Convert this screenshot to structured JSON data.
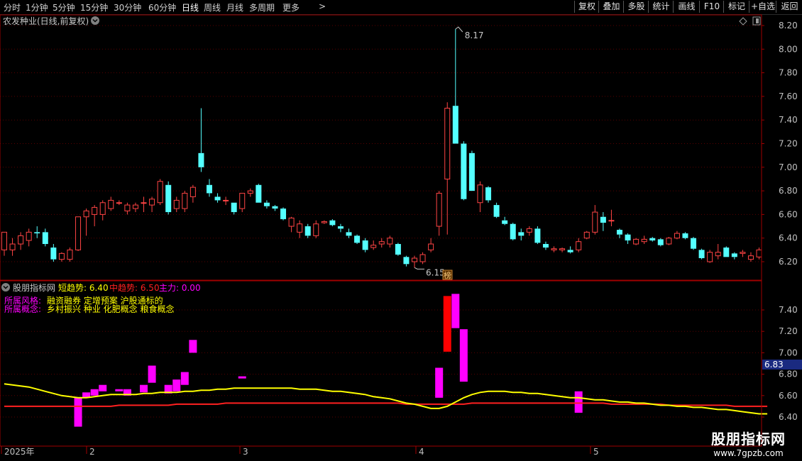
{
  "toolbar": {
    "periods": [
      "分时",
      "1分钟",
      "5分钟",
      "15分钟",
      "30分钟",
      "60分钟",
      "日线",
      "周线",
      "月线",
      "多周期",
      "更多"
    ],
    "active": "日线",
    "more_arrow": ">",
    "right_buttons": [
      "复权",
      "叠加",
      "多股",
      "统计",
      "画线",
      "F10",
      "标记",
      "+自选",
      "返回"
    ]
  },
  "main_panel": {
    "title": "农发种业(日线,前复权)",
    "dropdown_icon": "chevron-down-circle-icon",
    "high_label": "8.17",
    "low_label": "6.15",
    "badge": "榜"
  },
  "sub_panel": {
    "indicator_name": "股朋指标网",
    "legend": [
      {
        "label": "短趋势: 6.40",
        "color": "#ffff00"
      },
      {
        "label": "中趋势: 6.50",
        "color": "#ff2020"
      },
      {
        "label": "主力: 0.00",
        "color": "#ff00ff"
      }
    ],
    "style_label": "所属风格:",
    "style_value": "融资融券 定增预案 沪股通标的",
    "concept_label": "所属概念:",
    "concept_value": "乡村振兴 种业 化肥概念 粮食概念",
    "current_price_tag": "6.83"
  },
  "time_axis": [
    "2025年",
    "2",
    "3",
    "4",
    "5"
  ],
  "watermark": {
    "title": "股朋指标网",
    "url": "www.7gpzb.com"
  },
  "colors": {
    "up": "#ff4444",
    "down": "#54ffff",
    "short_trend": "#ffff00",
    "mid_trend": "#ff2020",
    "main_force": "#ff00ff",
    "grid": "#5a0000",
    "axis": "#a00000"
  },
  "chart_data": [
    {
      "type": "candlestick",
      "title": "农发种业(日线,前复权)",
      "ylim": [
        6.1,
        8.3
      ],
      "yticks": [
        6.2,
        6.4,
        6.6,
        6.8,
        7.0,
        7.2,
        7.4,
        7.6,
        7.8,
        8.0,
        8.2
      ],
      "ohlc": [
        [
          6.3,
          6.45,
          6.25,
          6.45
        ],
        [
          6.3,
          6.4,
          6.25,
          6.35
        ],
        [
          6.35,
          6.45,
          6.3,
          6.42
        ],
        [
          6.38,
          6.48,
          6.33,
          6.45
        ],
        [
          6.45,
          6.5,
          6.4,
          6.44
        ],
        [
          6.45,
          6.48,
          6.33,
          6.35
        ],
        [
          6.32,
          6.35,
          6.2,
          6.22
        ],
        [
          6.22,
          6.28,
          6.2,
          6.27
        ],
        [
          6.22,
          6.32,
          6.2,
          6.3
        ],
        [
          6.3,
          6.58,
          6.29,
          6.58
        ],
        [
          6.58,
          6.65,
          6.42,
          6.63
        ],
        [
          6.6,
          6.68,
          6.5,
          6.66
        ],
        [
          6.6,
          6.72,
          6.55,
          6.7
        ],
        [
          6.65,
          6.75,
          6.63,
          6.72
        ],
        [
          6.7,
          6.72,
          6.68,
          6.7
        ],
        [
          6.63,
          6.7,
          6.6,
          6.68
        ],
        [
          6.65,
          6.7,
          6.62,
          6.68
        ],
        [
          6.7,
          6.75,
          6.62,
          6.7
        ],
        [
          6.68,
          6.75,
          6.62,
          6.73
        ],
        [
          6.7,
          6.9,
          6.68,
          6.88
        ],
        [
          6.85,
          6.88,
          6.6,
          6.62
        ],
        [
          6.65,
          6.75,
          6.62,
          6.72
        ],
        [
          6.65,
          6.8,
          6.62,
          6.78
        ],
        [
          6.75,
          6.85,
          6.7,
          6.83
        ],
        [
          7.12,
          7.5,
          6.96,
          7.0
        ],
        [
          6.85,
          6.9,
          6.75,
          6.78
        ],
        [
          6.75,
          6.78,
          6.7,
          6.72
        ],
        [
          6.72,
          6.75,
          6.68,
          6.72
        ],
        [
          6.7,
          6.7,
          6.6,
          6.62
        ],
        [
          6.65,
          6.78,
          6.62,
          6.78
        ],
        [
          6.78,
          6.82,
          6.75,
          6.8
        ],
        [
          6.85,
          6.86,
          6.7,
          6.7
        ],
        [
          6.7,
          6.72,
          6.65,
          6.67
        ],
        [
          6.67,
          6.68,
          6.63,
          6.65
        ],
        [
          6.65,
          6.66,
          6.55,
          6.56
        ],
        [
          6.5,
          6.58,
          6.45,
          6.57
        ],
        [
          6.45,
          6.55,
          6.4,
          6.52
        ],
        [
          6.5,
          6.52,
          6.4,
          6.42
        ],
        [
          6.42,
          6.55,
          6.4,
          6.52
        ],
        [
          6.53,
          6.55,
          6.52,
          6.54
        ],
        [
          6.55,
          6.56,
          6.5,
          6.51
        ],
        [
          6.5,
          6.52,
          6.45,
          6.48
        ],
        [
          6.45,
          6.48,
          6.4,
          6.42
        ],
        [
          6.42,
          6.43,
          6.35,
          6.36
        ],
        [
          6.38,
          6.4,
          6.28,
          6.3
        ],
        [
          6.32,
          6.38,
          6.3,
          6.34
        ],
        [
          6.35,
          6.4,
          6.32,
          6.37
        ],
        [
          6.35,
          6.42,
          6.32,
          6.4
        ],
        [
          6.35,
          6.36,
          6.25,
          6.26
        ],
        [
          6.24,
          6.25,
          6.16,
          6.18
        ],
        [
          6.2,
          6.25,
          6.15,
          6.23
        ],
        [
          6.2,
          6.28,
          6.18,
          6.26
        ],
        [
          6.3,
          6.4,
          6.28,
          6.35
        ],
        [
          6.5,
          6.8,
          6.42,
          6.78
        ],
        [
          6.9,
          7.55,
          6.43,
          7.5
        ],
        [
          7.52,
          8.17,
          7.2,
          7.2
        ],
        [
          7.2,
          7.22,
          6.72,
          6.73
        ],
        [
          7.12,
          7.14,
          6.8,
          6.8
        ],
        [
          6.7,
          6.88,
          6.62,
          6.85
        ],
        [
          6.83,
          6.84,
          6.7,
          6.72
        ],
        [
          6.68,
          6.7,
          6.57,
          6.58
        ],
        [
          6.55,
          6.58,
          6.51,
          6.52
        ],
        [
          6.52,
          6.53,
          6.38,
          6.39
        ],
        [
          6.45,
          6.48,
          6.38,
          6.42
        ],
        [
          6.45,
          6.5,
          6.42,
          6.48
        ],
        [
          6.48,
          6.5,
          6.35,
          6.36
        ],
        [
          6.35,
          6.37,
          6.3,
          6.32
        ],
        [
          6.3,
          6.33,
          6.28,
          6.31
        ],
        [
          6.3,
          6.32,
          6.28,
          6.31
        ],
        [
          6.3,
          6.33,
          6.27,
          6.28
        ],
        [
          6.3,
          6.4,
          6.28,
          6.37
        ],
        [
          6.4,
          6.46,
          6.39,
          6.45
        ],
        [
          6.45,
          6.68,
          6.43,
          6.62
        ],
        [
          6.58,
          6.62,
          6.46,
          6.53
        ],
        [
          6.55,
          6.64,
          6.5,
          6.55
        ],
        [
          6.47,
          6.48,
          6.4,
          6.43
        ],
        [
          6.43,
          6.44,
          6.35,
          6.38
        ],
        [
          6.35,
          6.4,
          6.34,
          6.39
        ],
        [
          6.37,
          6.42,
          6.35,
          6.39
        ],
        [
          6.4,
          6.41,
          6.37,
          6.38
        ],
        [
          6.39,
          6.4,
          6.33,
          6.34
        ],
        [
          6.35,
          6.41,
          6.34,
          6.4
        ],
        [
          6.4,
          6.46,
          6.39,
          6.44
        ],
        [
          6.44,
          6.45,
          6.39,
          6.4
        ],
        [
          6.4,
          6.41,
          6.3,
          6.31
        ],
        [
          6.3,
          6.31,
          6.22,
          6.23
        ],
        [
          6.2,
          6.3,
          6.19,
          6.28
        ],
        [
          6.25,
          6.35,
          6.22,
          6.28
        ],
        [
          6.32,
          6.33,
          6.24,
          6.24
        ],
        [
          6.27,
          6.28,
          6.22,
          6.24
        ],
        [
          6.27,
          6.3,
          6.24,
          6.28
        ],
        [
          6.22,
          6.28,
          6.2,
          6.25
        ],
        [
          6.24,
          6.32,
          6.22,
          6.3
        ]
      ]
    },
    {
      "type": "indicator",
      "ylim": [
        6.32,
        7.6
      ],
      "yticks": [
        6.4,
        6.6,
        6.8,
        7.0,
        7.2,
        7.4
      ],
      "short_trend": [
        6.71,
        6.7,
        6.69,
        6.68,
        6.66,
        6.64,
        6.62,
        6.6,
        6.59,
        6.58,
        6.58,
        6.59,
        6.6,
        6.61,
        6.61,
        6.61,
        6.61,
        6.62,
        6.62,
        6.63,
        6.63,
        6.63,
        6.64,
        6.64,
        6.65,
        6.65,
        6.66,
        6.66,
        6.67,
        6.67,
        6.67,
        6.67,
        6.67,
        6.67,
        6.67,
        6.67,
        6.66,
        6.66,
        6.66,
        6.65,
        6.64,
        6.64,
        6.63,
        6.62,
        6.61,
        6.59,
        6.58,
        6.57,
        6.55,
        6.53,
        6.52,
        6.5,
        6.48,
        6.48,
        6.5,
        6.54,
        6.58,
        6.61,
        6.63,
        6.64,
        6.64,
        6.64,
        6.63,
        6.63,
        6.62,
        6.62,
        6.61,
        6.6,
        6.59,
        6.58,
        6.58,
        6.57,
        6.56,
        6.56,
        6.55,
        6.54,
        6.54,
        6.53,
        6.53,
        6.52,
        6.51,
        6.51,
        6.5,
        6.5,
        6.49,
        6.49,
        6.48,
        6.47,
        6.47,
        6.46,
        6.45,
        6.44,
        6.43,
        6.43
      ],
      "mid_trend": [
        6.5,
        6.5,
        6.5,
        6.5,
        6.5,
        6.5,
        6.5,
        6.5,
        6.5,
        6.5,
        6.5,
        6.5,
        6.5,
        6.5,
        6.51,
        6.51,
        6.51,
        6.51,
        6.51,
        6.51,
        6.51,
        6.52,
        6.52,
        6.52,
        6.52,
        6.52,
        6.52,
        6.53,
        6.53,
        6.53,
        6.53,
        6.53,
        6.53,
        6.53,
        6.53,
        6.53,
        6.53,
        6.53,
        6.53,
        6.53,
        6.53,
        6.53,
        6.53,
        6.53,
        6.53,
        6.53,
        6.53,
        6.53,
        6.53,
        6.52,
        6.52,
        6.52,
        6.52,
        6.52,
        6.52,
        6.52,
        6.52,
        6.53,
        6.53,
        6.53,
        6.53,
        6.53,
        6.53,
        6.53,
        6.53,
        6.53,
        6.53,
        6.53,
        6.53,
        6.53,
        6.53,
        6.53,
        6.53,
        6.53,
        6.52,
        6.52,
        6.52,
        6.52,
        6.52,
        6.52,
        6.52,
        6.51,
        6.51,
        6.51,
        6.51,
        6.51,
        6.51,
        6.51,
        6.51,
        6.5,
        6.5,
        6.5,
        6.5,
        6.5
      ],
      "main_force_bars": [
        {
          "i": 9,
          "top": 6.58,
          "bottom": 6.31
        },
        {
          "i": 10,
          "top": 6.63,
          "bottom": 6.58
        },
        {
          "i": 11,
          "top": 6.66,
          "bottom": 6.6
        },
        {
          "i": 12,
          "top": 6.7,
          "bottom": 6.64
        },
        {
          "i": 14,
          "top": 6.66,
          "bottom": 6.64
        },
        {
          "i": 15,
          "top": 6.66,
          "bottom": 6.6
        },
        {
          "i": 17,
          "top": 6.7,
          "bottom": 6.63
        },
        {
          "i": 18,
          "top": 6.88,
          "bottom": 6.72
        },
        {
          "i": 20,
          "top": 6.7,
          "bottom": 6.62
        },
        {
          "i": 21,
          "top": 6.75,
          "bottom": 6.64
        },
        {
          "i": 22,
          "top": 6.82,
          "bottom": 6.7
        },
        {
          "i": 23,
          "top": 7.12,
          "bottom": 7.0
        },
        {
          "i": 29,
          "top": 6.78,
          "bottom": 6.76
        },
        {
          "i": 53,
          "top": 6.86,
          "bottom": 6.58
        },
        {
          "i": 54,
          "top": 7.53,
          "bottom": 7.01,
          "color": "#ff0000"
        },
        {
          "i": 55,
          "top": 7.55,
          "bottom": 7.23
        },
        {
          "i": 56,
          "top": 7.22,
          "bottom": 6.73
        },
        {
          "i": 70,
          "top": 6.64,
          "bottom": 6.44
        }
      ]
    }
  ]
}
